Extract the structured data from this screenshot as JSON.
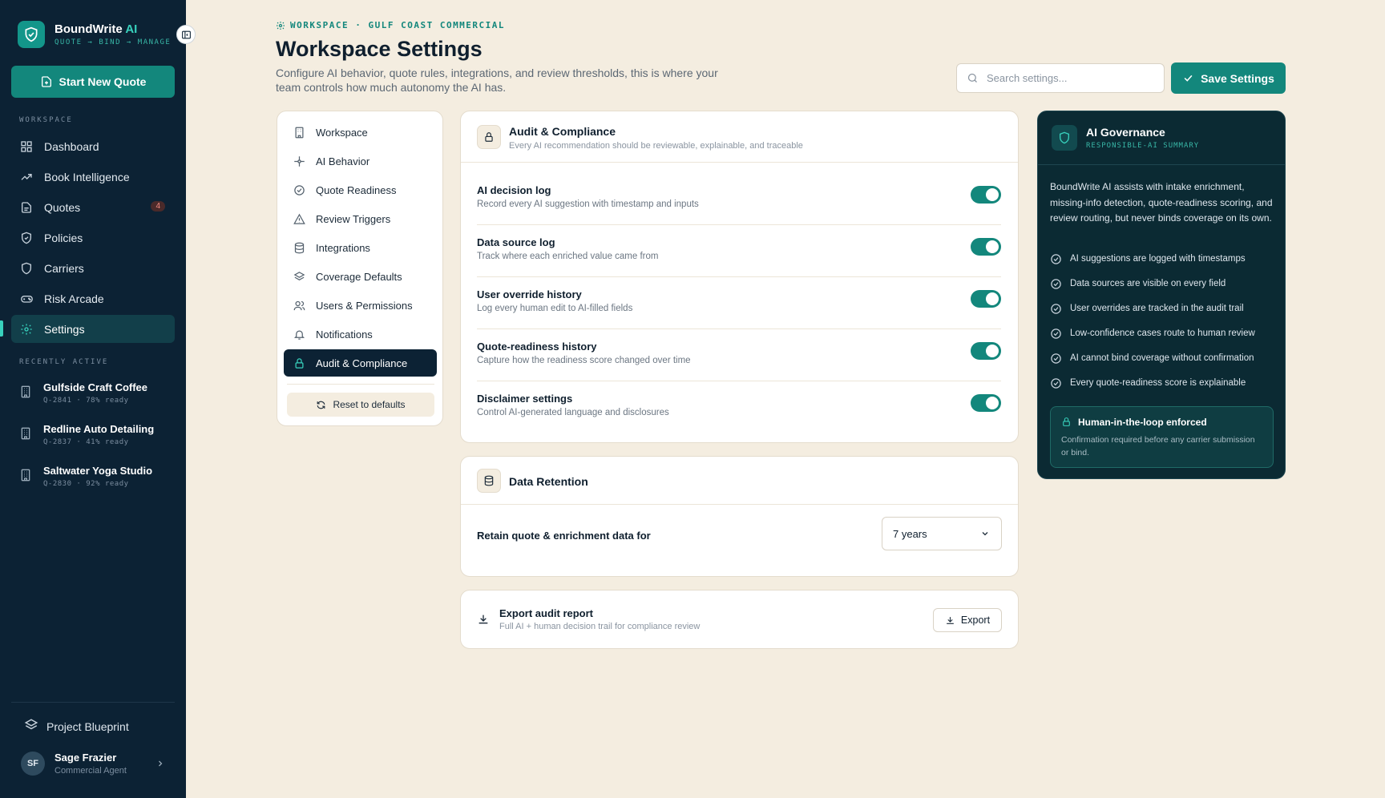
{
  "brand": {
    "name": "BoundWrite",
    "name_ai": "AI",
    "tagline": "QUOTE → BIND → MANAGE"
  },
  "sidebar": {
    "new_quote_label": "Start New Quote",
    "workspace_label": "WORKSPACE",
    "items": [
      {
        "label": "Dashboard",
        "icon": "grid-icon"
      },
      {
        "label": "Book Intelligence",
        "icon": "trend-icon"
      },
      {
        "label": "Quotes",
        "icon": "document-icon",
        "badge": "4"
      },
      {
        "label": "Policies",
        "icon": "shield-icon"
      },
      {
        "label": "Carriers",
        "icon": "shield-outline-icon"
      },
      {
        "label": "Risk Arcade",
        "icon": "gamepad-icon"
      },
      {
        "label": "Settings",
        "icon": "gear-icon",
        "active": true
      }
    ],
    "recent_label": "RECENTLY ACTIVE",
    "recent": [
      {
        "name": "Gulfside Craft Coffee",
        "meta": "Q-2841 · 78% ready"
      },
      {
        "name": "Redline Auto Detailing",
        "meta": "Q-2837 · 41% ready"
      },
      {
        "name": "Saltwater Yoga Studio",
        "meta": "Q-2830 · 92% ready"
      }
    ],
    "blueprint_label": "Project Blueprint",
    "user": {
      "initials": "SF",
      "name": "Sage Frazier",
      "role": "Commercial Agent"
    }
  },
  "header": {
    "breadcrumb": "WORKSPACE · GULF COAST COMMERCIAL",
    "title": "Workspace Settings",
    "description": "Configure AI behavior, quote rules, integrations, and review thresholds, this is where your team controls how much autonomy the AI has.",
    "search_placeholder": "Search settings...",
    "save_label": "Save Settings"
  },
  "settings_nav": {
    "items": [
      {
        "label": "Workspace",
        "icon": "building-icon"
      },
      {
        "label": "AI Behavior",
        "icon": "sparkle-icon"
      },
      {
        "label": "Quote Readiness",
        "icon": "check-circle-icon"
      },
      {
        "label": "Review Triggers",
        "icon": "warning-icon"
      },
      {
        "label": "Integrations",
        "icon": "database-icon"
      },
      {
        "label": "Coverage Defaults",
        "icon": "layers-icon"
      },
      {
        "label": "Users & Permissions",
        "icon": "users-icon"
      },
      {
        "label": "Notifications",
        "icon": "bell-icon"
      },
      {
        "label": "Audit & Compliance",
        "icon": "lock-icon",
        "active": true
      }
    ],
    "reset_label": "Reset to defaults"
  },
  "audit": {
    "title": "Audit & Compliance",
    "subtitle": "Every AI recommendation should be reviewable, explainable, and traceable",
    "rows": [
      {
        "title": "AI decision log",
        "desc": "Record every AI suggestion with timestamp and inputs",
        "enabled": true
      },
      {
        "title": "Data source log",
        "desc": "Track where each enriched value came from",
        "enabled": true
      },
      {
        "title": "User override history",
        "desc": "Log every human edit to AI-filled fields",
        "enabled": true
      },
      {
        "title": "Quote-readiness history",
        "desc": "Capture how the readiness score changed over time",
        "enabled": true
      },
      {
        "title": "Disclaimer settings",
        "desc": "Control AI-generated language and disclosures",
        "enabled": true
      }
    ]
  },
  "retention": {
    "title": "Data Retention",
    "label": "Retain quote & enrichment data for",
    "value": "7 years"
  },
  "export": {
    "title": "Export audit report",
    "subtitle": "Full AI + human decision trail for compliance review",
    "button": "Export"
  },
  "governance": {
    "title": "AI Governance",
    "subtitle": "RESPONSIBLE-AI SUMMARY",
    "description": "BoundWrite AI assists with intake enrichment, missing-info detection, quote-readiness scoring, and review routing, but never binds coverage on its own.",
    "items": [
      "AI suggestions are logged with timestamps",
      "Data sources are visible on every field",
      "User overrides are tracked in the audit trail",
      "Low-confidence cases route to human review",
      "AI cannot bind coverage without confirmation",
      "Every quote-readiness score is explainable"
    ],
    "callout_title": "Human-in-the-loop enforced",
    "callout_text": "Confirmation required before any carrier submission or bind."
  },
  "colors": {
    "accent": "#13877c",
    "sidebar": "#0c2234",
    "background": "#f4ede0",
    "governance": "#0b2a33"
  }
}
